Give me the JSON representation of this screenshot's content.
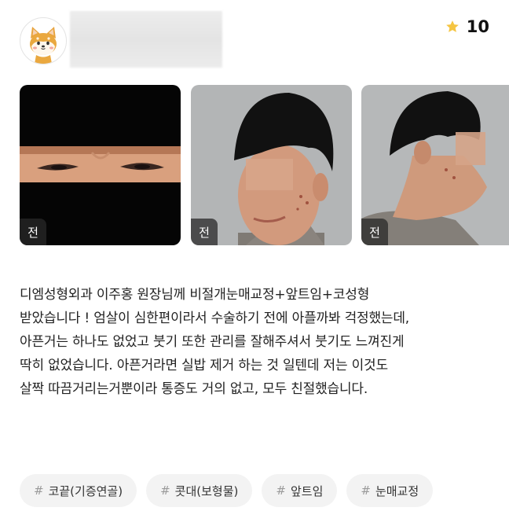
{
  "reviewer": {
    "avatar_icon": "shiba-dog-avatar-icon"
  },
  "rating": {
    "icon": "star-icon",
    "value": "10",
    "star_color": "#f5c542"
  },
  "photos": [
    {
      "label": "전",
      "kind": "eyes-closeup-photo"
    },
    {
      "label": "전",
      "kind": "front-face-photo"
    },
    {
      "label": "전",
      "kind": "side-profile-photo"
    }
  ],
  "review": {
    "text": "디엠성형외과 이주홍 원장님께 비절개눈매교정+앞트임+코성형\n받았습니다 ! 엄살이 심한편이라서 수술하기 전에 아플까봐 걱정했는데,\n아픈거는 하나도 없었고 붓기 또한 관리를 잘해주셔서 붓기도 느껴진게\n딱히 없었습니다. 아픈거라면 실밥 제거 하는 것 일텐데 저는 이것도\n살짝 따끔거리는거뿐이라 통증도 거의 없고, 모두 친절했습니다."
  },
  "tags": [
    {
      "hash": "#",
      "label": "코끝(기증연골)"
    },
    {
      "hash": "#",
      "label": "콧대(보형물)"
    },
    {
      "hash": "#",
      "label": "앞트임"
    },
    {
      "hash": "#",
      "label": "눈매교정"
    }
  ]
}
